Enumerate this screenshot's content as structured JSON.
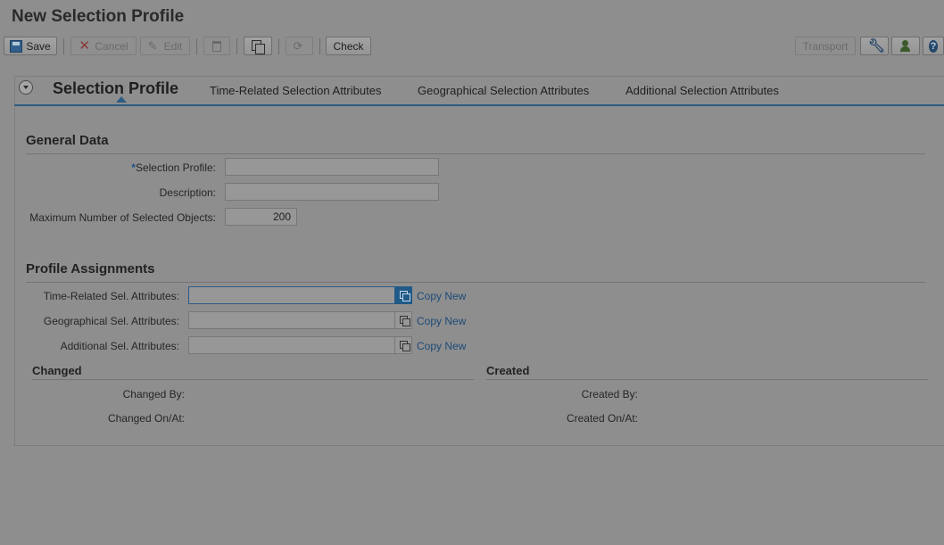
{
  "page": {
    "title": "New Selection Profile"
  },
  "toolbar": {
    "save": "Save",
    "cancel": "Cancel",
    "edit": "Edit",
    "check": "Check",
    "transport": "Transport",
    "icons": [
      "save-icon",
      "cancel-icon",
      "edit-icon",
      "delete-icon",
      "copy-icon",
      "refresh-icon",
      "wrench-icon",
      "user-settings-icon",
      "help-icon"
    ]
  },
  "tabs": {
    "active": "Selection Profile",
    "items": [
      "Time-Related Selection Attributes",
      "Geographical Selection Attributes",
      "Additional Selection Attributes"
    ]
  },
  "general": {
    "title": "General Data",
    "required_mark": "*",
    "selection_profile_label": "Selection Profile:",
    "selection_profile_value": "",
    "description_label": "Description:",
    "description_value": "",
    "max_objects_label": "Maximum Number of Selected Objects:",
    "max_objects_value": "200"
  },
  "assignments": {
    "title": "Profile Assignments",
    "copy_new": "Copy New",
    "rows": [
      {
        "label": "Time-Related Sel. Attributes:",
        "value": ""
      },
      {
        "label": "Geographical Sel. Attributes:",
        "value": ""
      },
      {
        "label": "Additional Sel. Attributes:",
        "value": ""
      }
    ]
  },
  "changed": {
    "title": "Changed",
    "by_label": "Changed By:",
    "on_label": "Changed On/At:"
  },
  "created": {
    "title": "Created",
    "by_label": "Created By:",
    "on_label": "Created On/At:"
  },
  "colors": {
    "accent": "#2e5b82",
    "link": "#1d4a78",
    "required": "#1f4f86"
  }
}
